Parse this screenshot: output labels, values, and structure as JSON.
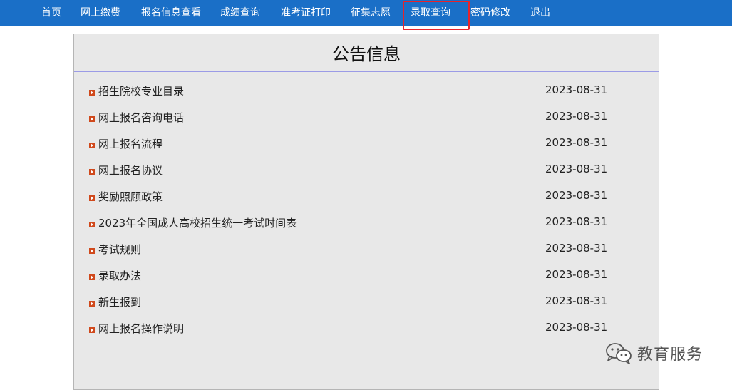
{
  "nav": {
    "items": [
      {
        "label": "首页"
      },
      {
        "label": "网上缴费"
      },
      {
        "label": "报名信息查看"
      },
      {
        "label": "成绩查询"
      },
      {
        "label": "准考证打印"
      },
      {
        "label": "征集志愿"
      },
      {
        "label": "录取查询"
      },
      {
        "label": "密码修改"
      },
      {
        "label": "退出"
      }
    ],
    "active_index": 6
  },
  "panel": {
    "title": "公告信息",
    "notices": [
      {
        "title": "招生院校专业目录",
        "date": "2023-08-31"
      },
      {
        "title": "网上报名咨询电话",
        "date": "2023-08-31"
      },
      {
        "title": "网上报名流程",
        "date": "2023-08-31"
      },
      {
        "title": "网上报名协议",
        "date": "2023-08-31"
      },
      {
        "title": "奖励照顾政策",
        "date": "2023-08-31"
      },
      {
        "title": "2023年全国成人高校招生统一考试时间表",
        "date": "2023-08-31"
      },
      {
        "title": "考试规则",
        "date": "2023-08-31"
      },
      {
        "title": "录取办法",
        "date": "2023-08-31"
      },
      {
        "title": "新生报到",
        "date": "2023-08-31"
      },
      {
        "title": "网上报名操作说明",
        "date": "2023-08-31"
      }
    ]
  },
  "watermark": {
    "text": "教育服务",
    "icon": "wechat-icon"
  },
  "colors": {
    "nav_bg": "#1a6fc7",
    "active_highlight": "#e8232a",
    "panel_bg": "#e8e8e8",
    "title_rule": "#9b9be6",
    "bullet": "#d0491c"
  }
}
